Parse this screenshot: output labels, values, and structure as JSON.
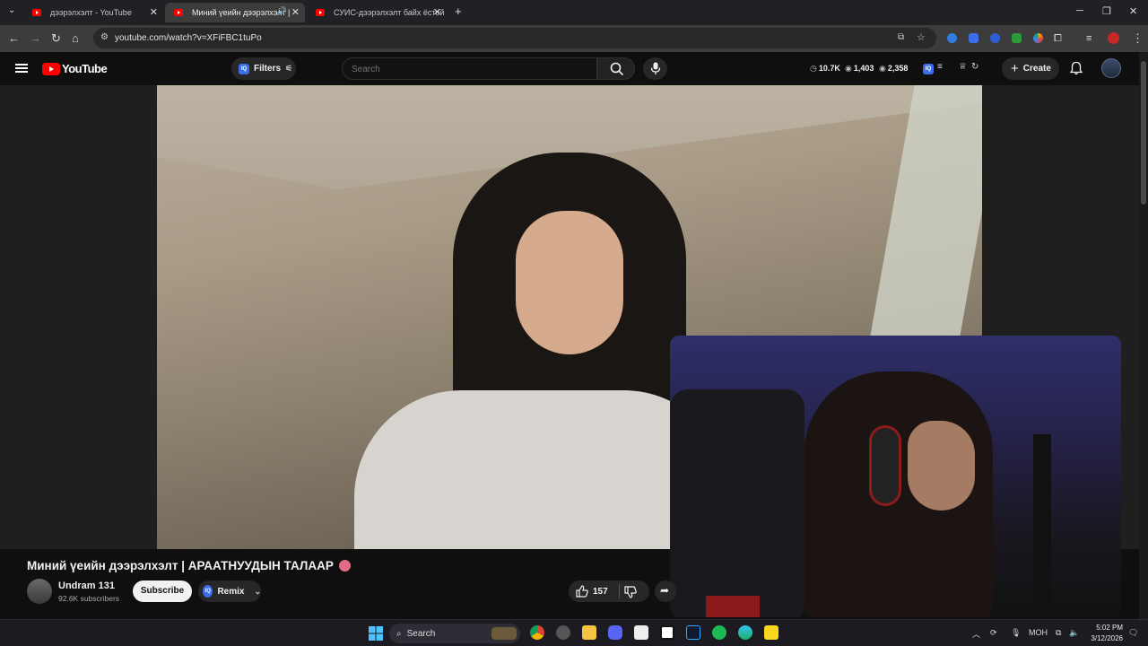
{
  "browser": {
    "tabs": [
      {
        "title": "дээрэлхэлт - YouTube",
        "active": false
      },
      {
        "title": "Миний үеийн дээрэлхэлт |",
        "active": true
      },
      {
        "title": "СУИС-дээрэлхэлт байх ёстой",
        "active": false
      }
    ],
    "url": "youtube.com/watch?v=XFiFBC1tuPo"
  },
  "youtube": {
    "logo_text": "YouTube",
    "filters_label": "Filters",
    "iq_badge": "IQ",
    "search_placeholder": "Search",
    "stats": [
      {
        "icon": "clock-icon",
        "value": "10.7K"
      },
      {
        "icon": "eye-icon",
        "value": "1,403"
      },
      {
        "icon": "eye-icon",
        "value": "2,358"
      }
    ],
    "create_label": "Create"
  },
  "video": {
    "title": "Миний үеийн дээрэлхэлт | АРААТНУУДЫН ТАЛААР",
    "channel_name": "Undram 131",
    "subscribers": "92.6K subscribers",
    "subscribe_label": "Subscribe",
    "remix_label": "Remix",
    "likes": "157"
  },
  "taskbar": {
    "search_label": "Search",
    "language": "МОН",
    "time": "5:02 PM",
    "date": "3/12/2026"
  },
  "colors": {
    "accent_red": "#ff0000",
    "background": "#0f0f0f",
    "chip": "#272727"
  }
}
